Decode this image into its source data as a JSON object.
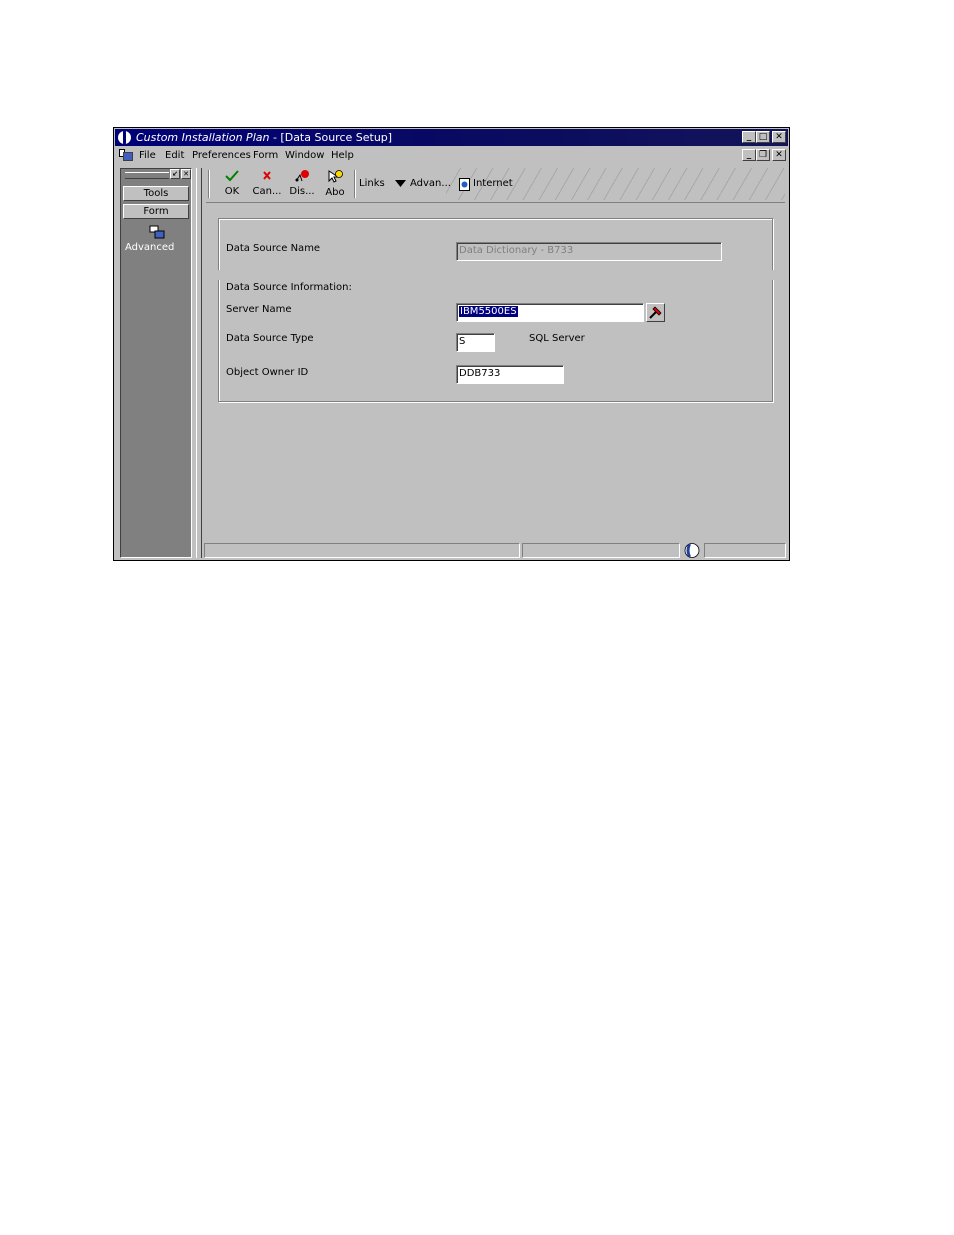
{
  "window": {
    "app_name": "Custom Installation Plan",
    "title_suffix": " - [Data Source Setup]"
  },
  "menubar": {
    "items": [
      "File",
      "Edit",
      "Preferences",
      "Form",
      "Window",
      "Help"
    ]
  },
  "left_panel": {
    "tools_label": "Tools",
    "form_label": "Form",
    "advanced_label": "Advanced"
  },
  "toolbar": {
    "ok_label": "OK",
    "cancel_label": "Can...",
    "display_label": "Dis...",
    "about_label": "Abo",
    "links_label": "Links",
    "advanced_label": "Advan...",
    "internet_label": "Internet"
  },
  "form": {
    "data_source_name_label": "Data Source Name",
    "data_source_name_value": "Data Dictionary - B733",
    "group_label": "Data Source Information:",
    "server_name_label": "Server Name",
    "server_name_value": "IBM5500ES",
    "data_source_type_label": "Data Source Type",
    "data_source_type_value": "S",
    "data_source_type_desc": "SQL Server",
    "object_owner_label": "Object Owner ID",
    "object_owner_value": "DDB733"
  },
  "colors": {
    "title_bar": "#000078",
    "face": "#c0c0c0",
    "panel": "#808080",
    "selection": "#000080"
  }
}
